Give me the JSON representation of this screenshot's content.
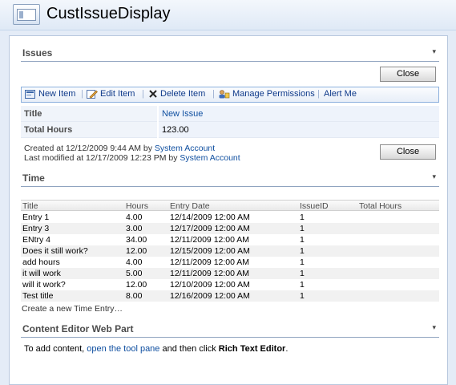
{
  "page": {
    "title": "CustIssueDisplay"
  },
  "issues": {
    "title": "Issues",
    "menu_glyph": "▾",
    "close_label": "Close",
    "toolbar": [
      {
        "label": "New Item",
        "icon": "new-item-icon"
      },
      {
        "label": "Edit Item",
        "icon": "edit-item-icon"
      },
      {
        "label": "Delete Item",
        "icon": "delete-item-icon"
      },
      {
        "label": "Manage Permissions",
        "icon": "manage-permissions-icon"
      },
      {
        "label": "Alert Me",
        "icon": ""
      }
    ],
    "fields": [
      {
        "label": "Title",
        "value": "New Issue"
      },
      {
        "label": "Total Hours",
        "value": "123.00"
      }
    ],
    "created_prefix": "Created at 12/12/2009 9:44 AM  by",
    "created_by": "System Account",
    "modified_prefix": "Last modified at 12/17/2009 12:23 PM  by",
    "modified_by": "System Account"
  },
  "time": {
    "title": "Time",
    "menu_glyph": "▾",
    "columns": [
      "Title",
      "Hours",
      "Entry Date",
      "IssueID",
      "Total Hours"
    ],
    "rows": [
      [
        "Entry 1",
        "4.00",
        "12/14/2009 12:00 AM",
        "1",
        ""
      ],
      [
        "Entry 3",
        "3.00",
        "12/17/2009 12:00 AM",
        "1",
        ""
      ],
      [
        "ENtry 4",
        "34.00",
        "12/11/2009 12:00 AM",
        "1",
        ""
      ],
      [
        "Does it still work?",
        "12.00",
        "12/15/2009 12:00 AM",
        "1",
        ""
      ],
      [
        "add hours",
        "4.00",
        "12/11/2009 12:00 AM",
        "1",
        ""
      ],
      [
        "it will work",
        "5.00",
        "12/11/2009 12:00 AM",
        "1",
        ""
      ],
      [
        "will it work?",
        "12.00",
        "12/10/2009 12:00 AM",
        "1",
        ""
      ],
      [
        "Test title",
        "8.00",
        "12/16/2009 12:00 AM",
        "1",
        ""
      ]
    ],
    "create_link": "Create a new Time Entry…"
  },
  "content_editor": {
    "title": "Content Editor Web Part",
    "menu_glyph": "▾",
    "text_before": "To add content, ",
    "link": "open the tool pane",
    "text_middle": " and then click ",
    "bold": "Rich Text Editor",
    "text_after": "."
  }
}
